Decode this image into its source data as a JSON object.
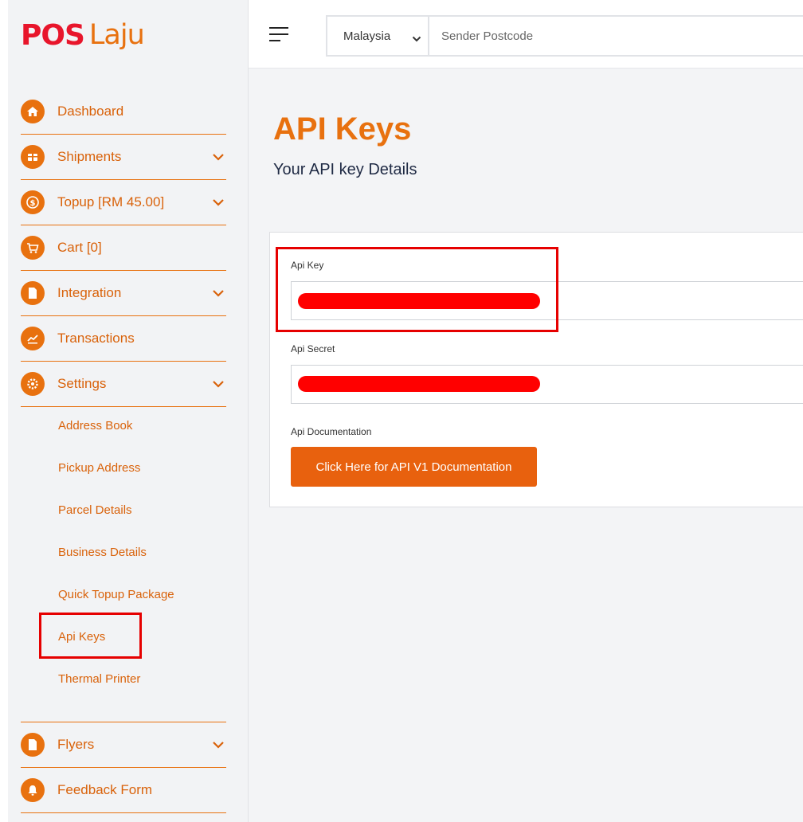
{
  "brand": {
    "pos": "POS",
    "laju": "Laju"
  },
  "sidebar": {
    "items": [
      {
        "label": "Dashboard",
        "icon": "home-icon"
      },
      {
        "label": "Shipments",
        "icon": "package-icon"
      },
      {
        "label": "Topup [RM 45.00]",
        "icon": "coin-icon"
      },
      {
        "label": "Cart [0]",
        "icon": "cart-icon"
      },
      {
        "label": "Integration",
        "icon": "document-icon"
      },
      {
        "label": "Transactions",
        "icon": "trend-icon"
      },
      {
        "label": "Settings",
        "icon": "gear-icon"
      }
    ],
    "settings_sub": [
      "Address Book",
      "Pickup Address",
      "Parcel Details",
      "Business Details",
      "Quick Topup Package",
      "Api Keys",
      "Thermal Printer"
    ],
    "bottom_items": [
      {
        "label": "Flyers",
        "icon": "document-icon"
      },
      {
        "label": "Feedback Form",
        "icon": "bell-icon"
      }
    ]
  },
  "topbar": {
    "country": "Malaysia",
    "postcode_placeholder": "Sender Postcode"
  },
  "main": {
    "title": "API Keys",
    "subtitle": "Your API key Details",
    "api_key_label": "Api Key",
    "api_secret_label": "Api Secret",
    "api_doc_label": "Api Documentation",
    "doc_button": "Click Here for API V1 Documentation"
  },
  "colors": {
    "accent": "#e8710f",
    "brand_red": "#e8152b",
    "highlight": "#e60000",
    "redaction": "#ff0000"
  }
}
